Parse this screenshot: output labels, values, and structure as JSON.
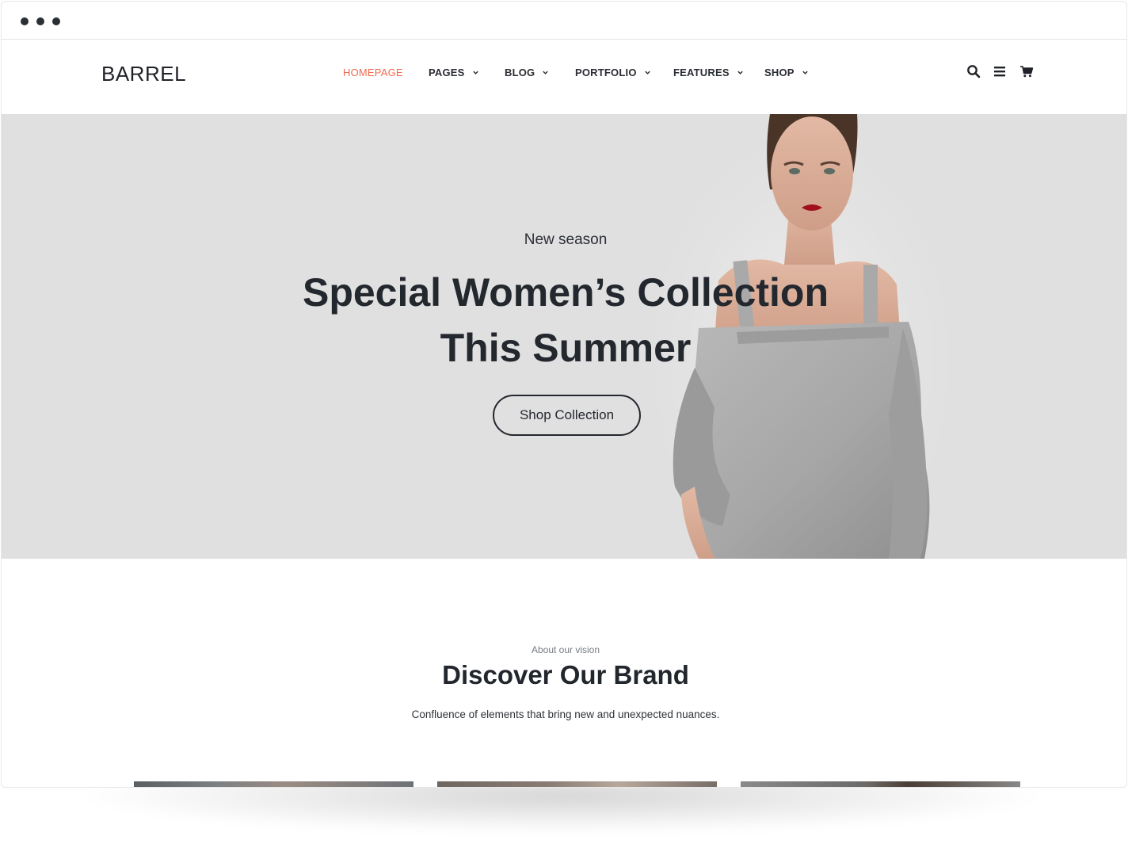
{
  "brand": {
    "logo": "BARREL"
  },
  "nav": {
    "items": [
      {
        "label": "HOMEPAGE",
        "active": true,
        "dropdown": false
      },
      {
        "label": "PAGES",
        "active": false,
        "dropdown": true
      },
      {
        "label": "BLOG",
        "active": false,
        "dropdown": true
      },
      {
        "label": "PORTFOLIO",
        "active": false,
        "dropdown": true
      },
      {
        "label": "FEATURES",
        "active": false,
        "dropdown": true
      },
      {
        "label": "SHOP",
        "active": false,
        "dropdown": true
      }
    ]
  },
  "header_icons": [
    "search-icon",
    "menu-icon",
    "cart-icon"
  ],
  "hero": {
    "eyebrow": "New season",
    "title_line1": "Special Women’s Collection",
    "title_line2": "This Summer",
    "button_label": "Shop Collection"
  },
  "about": {
    "eyebrow": "About our vision",
    "title": "Discover Our Brand",
    "description": "Confluence of elements that bring new and unexpected nuances."
  },
  "colors": {
    "accent": "#ee6b4f",
    "text_dark": "#23272e",
    "hero_bg": "#e0e0e0"
  }
}
